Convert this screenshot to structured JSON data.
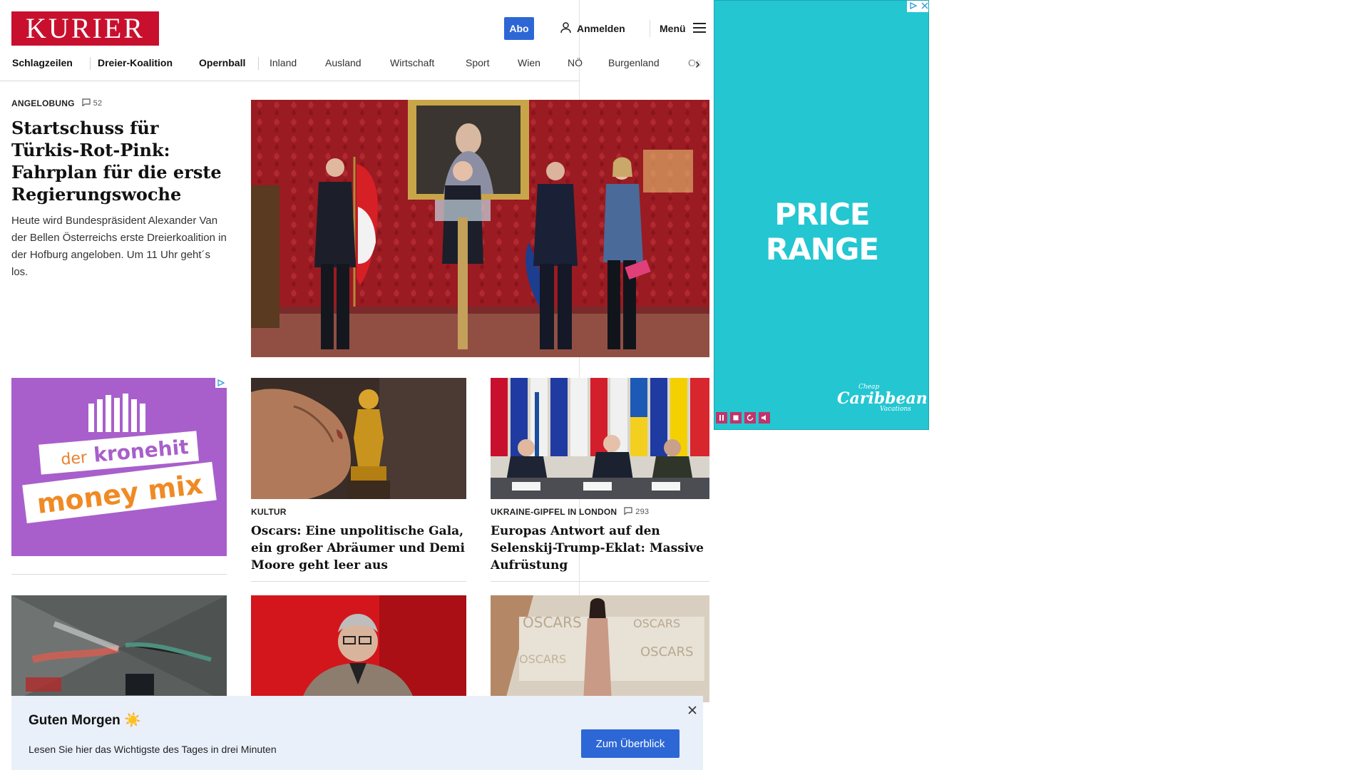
{
  "header": {
    "logo": "KURIER",
    "abo_label": "Abo",
    "login_label": "Anmelden",
    "menu_label": "Menü"
  },
  "nav": {
    "items": [
      "Schlagzeilen",
      "Dreier-Koalition",
      "Opernball",
      "Inland",
      "Ausland",
      "Wirtschaft",
      "Sport",
      "Wien",
      "NÖ",
      "Burgenland",
      "Oö"
    ]
  },
  "lead": {
    "kicker": "ANGELOBUNG",
    "comments": "52",
    "headline": "Startschuss für Türkis-Rot-Pink: Fahrplan für die erste Regierungswoche",
    "teaser": "Heute wird Bundespräsident Alexander Van der Bellen Österreichs erste Dreierkoalition in der Hofburg angeloben. Um 11 Uhr geht´s los."
  },
  "ad_left": {
    "line1": "der",
    "line2": "kronehit",
    "line3": "money mix"
  },
  "cards": [
    {
      "kicker": "KULTUR",
      "comments": "",
      "headline": "Oscars: Eine unpolitische Gala, ein großer Abräumer und Demi Moore geht leer aus"
    },
    {
      "kicker": "UKRAINE-GIPFEL IN LONDON",
      "comments": "293",
      "headline": "Europas Antwort auf den Selenskij-Trump-Eklat: Massive Aufrüstung"
    }
  ],
  "toast": {
    "title": "Guten Morgen ☀️",
    "text": "Lesen Sie hier das Wichtigste des Tages in drei Minuten",
    "button": "Zum Überblick"
  },
  "ad_right": {
    "headline": "PRICE RANGE",
    "brand_top": "Cheap",
    "brand_main": "Caribbean",
    "brand_bottom": "Vacations"
  },
  "colors": {
    "brand_red": "#c8102e",
    "accent_blue": "#2d67d6",
    "ad_cyan": "#24c6d1",
    "ad_purple": "#a85fcb"
  }
}
